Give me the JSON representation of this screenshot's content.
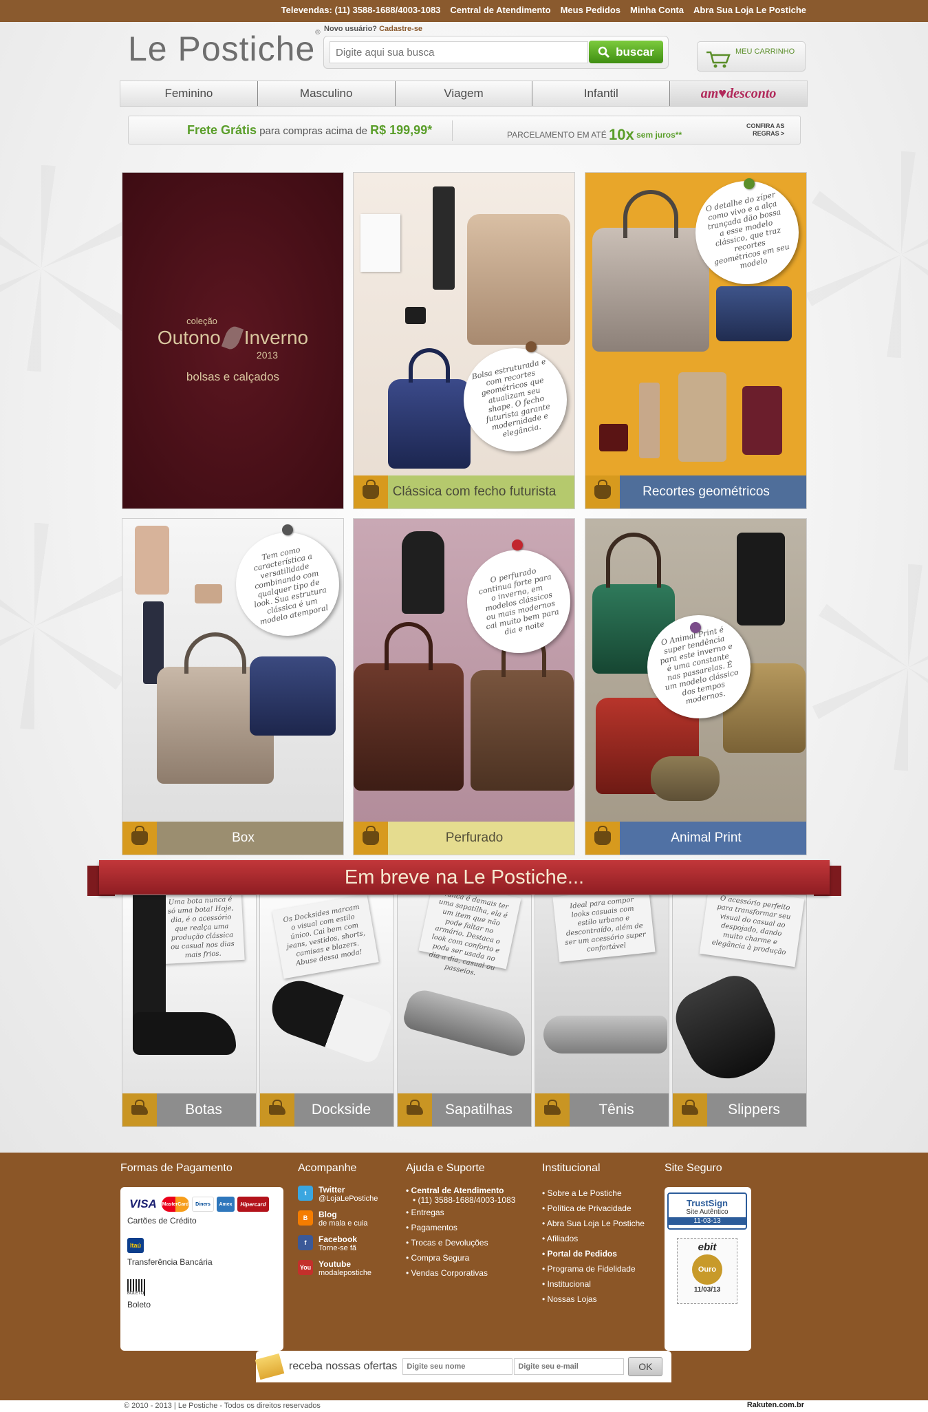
{
  "topbar": {
    "links": [
      "Televendas: (11) 3588-1688/4003-1083",
      "Central de Atendimento",
      "Meus Pedidos",
      "Minha Conta",
      "Abra Sua Loja Le Postiche"
    ]
  },
  "header": {
    "logo": "Le Postiche",
    "logo_mark": "®",
    "new_user_label": "Novo usuário?",
    "signup_link": "Cadastre-se",
    "search_placeholder": "Digite aqui sua busca",
    "search_button": "buscar",
    "cart_label": "MEU CARRINHO"
  },
  "nav": {
    "items": [
      "Feminino",
      "Masculino",
      "Viagem",
      "Infantil",
      "am♥desconto"
    ]
  },
  "promo": {
    "free_shipping": "Frete Grátis",
    "free_shipping_text": "para compras acima de",
    "free_shipping_value": "R$ 199,99*",
    "installments_text": "PARCELAMENTO EM ATÉ",
    "installments_value": "10x",
    "installments_suffix": "sem juros**",
    "rules_line1": "CONFIRA AS",
    "rules_line2": "REGRAS >"
  },
  "collection": {
    "intro_small": "coleção",
    "title_left": "Outono",
    "title_right": "Inverno",
    "year": "2013",
    "subtitle": "bolsas e calçados"
  },
  "tiles": [
    {
      "caption": "Clássica com fecho futurista",
      "note": "Bolsa estruturada e com recortes geométricos que atualizam seu shape. O fecho futurista garante modernidade e elegância."
    },
    {
      "caption": "Recortes geométricos",
      "note": "O detalhe do zíper como vivo e a alça trançada dão bossa a esse modelo clássico, que traz recortes geométricos em seu modelo"
    },
    {
      "caption": "Box",
      "note": "Tem como característica a versatilidade combinando com qualquer tipo de look. Sua estrutura clássica é um modelo atemporal"
    },
    {
      "caption": "Perfurado",
      "note": "O perfurado continua forte para o inverno, em modelos clássicos ou mais modernos cai muito bem para dia e noite"
    },
    {
      "caption": "Animal Print",
      "note": "O Animal Print é super tendência para este inverno e é uma constante nas passarelas. É um modelo clássico dos tempos modernos."
    }
  ],
  "coming_soon": {
    "title": "Em breve na Le Postiche...",
    "items": [
      {
        "caption": "Botas",
        "note": "Uma bota nunca é só uma bota! Hoje, dia, é o acessório que realça uma produção clássica ou casual nos dias mais frios."
      },
      {
        "caption": "Dockside",
        "note": "Os Docksides marcam o visual com estilo único. Cai bem com jeans, vestidos, shorts, camisas e blazers. Abuse dessa moda!"
      },
      {
        "caption": "Sapatilhas",
        "note": "Nunca é demais ter uma sapatilha, ela é um item que não pode faltar no armário. Destaca o look com conforto e pode ser usada no dia a dia, casual ou passeios."
      },
      {
        "caption": "Tênis",
        "note": "Ideal para compor looks casuais com estilo urbano e descontraído, além de ser um acessório super confortável"
      },
      {
        "caption": "Slippers",
        "note": "O acessório perfeito para transformar seu visual do casual ao despojado, dando muito charme e elegância à produção"
      }
    ]
  },
  "footer": {
    "payment_title": "Formas de Pagamento",
    "card_brands": [
      "VISA",
      "MasterCard",
      "Diners",
      "Amex",
      "Hipercard"
    ],
    "credit_label": "Cartões de Crédito",
    "bank_brand": "Itaú",
    "transfer_label": "Transferência Bancária",
    "boleto_icon_label": "BOLETO",
    "boleto_label": "Boleto",
    "follow_title": "Acompanhe",
    "social": [
      {
        "title": "Twitter",
        "sub": "@LojaLePostiche",
        "icon": "twitter-icon",
        "color": "#3aa6e0",
        "glyph": "t"
      },
      {
        "title": "Blog",
        "sub": "de mala e cuia",
        "icon": "blogger-icon",
        "color": "#f57d00",
        "glyph": "B"
      },
      {
        "title": "Facebook",
        "sub": "Torne-se fã",
        "icon": "facebook-icon",
        "color": "#3b5998",
        "glyph": "f"
      },
      {
        "title": "Youtube",
        "sub": "modalepostiche",
        "icon": "youtube-icon",
        "color": "#c4302b",
        "glyph": "You"
      }
    ],
    "help_title": "Ajuda e Suporte",
    "help_bold": "Central de Atendimento",
    "help_phone": "(11) 3588-1688/4003-1083",
    "help_links": [
      "Entregas",
      "Pagamentos",
      "Trocas e Devoluções",
      "Compra Segura",
      "Vendas Corporativas"
    ],
    "inst_title": "Institucional",
    "inst_links": [
      "Sobre a Le Postiche",
      "Política de Privacidade",
      "Abra Sua Loja Le Postiche",
      "Afiliados",
      "Portal de Pedidos",
      "Programa de Fidelidade",
      "Institucional",
      "Nossas Lojas"
    ],
    "secure_title": "Site Seguro",
    "trustsign_name": "TrustSign",
    "trustsign_sub": "Site Autêntico",
    "trustsign_date": "11-03-13",
    "ebit_name": "ebit",
    "ebit_level": "Ouro",
    "ebit_date": "11/03/13",
    "newsletter_label": "receba nossas ofertas",
    "newsletter_name_placeholder": "Digite seu nome",
    "newsletter_email_placeholder": "Digite seu e-mail",
    "newsletter_button": "OK",
    "copyright": "© 2010 - 2013 | Le Postiche - Todos os direitos reservados",
    "partner": "Rakuten.com.br"
  },
  "colors": {
    "brand_brown": "#8b5627",
    "accent_green": "#5a9e2a",
    "gold": "#d79a1e",
    "banner_red": "#b02c30"
  }
}
